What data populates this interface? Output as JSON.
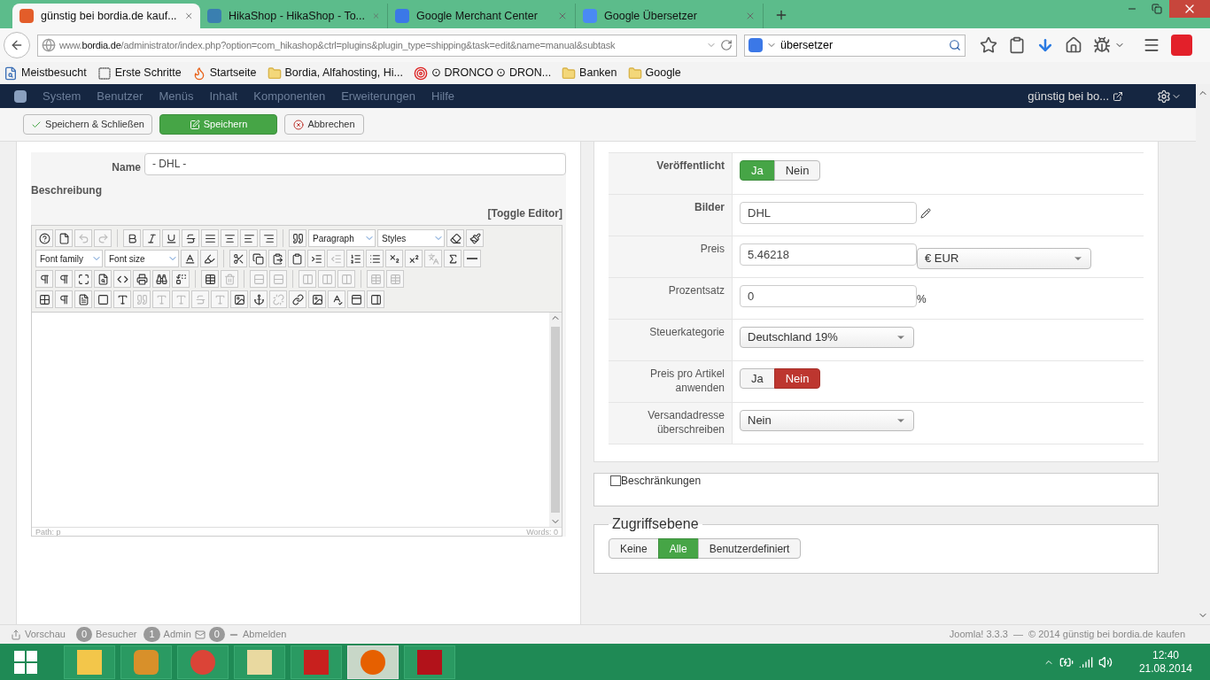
{
  "browser": {
    "tabs": [
      {
        "title": "günstig bei bordia.de kauf...",
        "kind": "joomla",
        "selected": true
      },
      {
        "title": "HikaShop - HikaShop - To...",
        "kind": "hika",
        "selected": false
      },
      {
        "title": "Google Merchant Center",
        "kind": "google",
        "selected": false
      },
      {
        "title": "Google Übersetzer",
        "kind": "translate",
        "selected": false
      }
    ],
    "url": {
      "prefix": "www.",
      "domain": "bordia.de",
      "path": "/administrator/index.php?option=com_hikashop&ctrl=plugins&plugin_type=shipping&task=edit&name=manual&subtask"
    },
    "search": {
      "value": "übersetzer"
    },
    "bookmarks": [
      {
        "label": "Meistbesucht",
        "kind": "page"
      },
      {
        "label": "Erste Schritte",
        "kind": "dashed"
      },
      {
        "label": "Startseite",
        "kind": "fire"
      },
      {
        "label": "Bordia, Alfahosting, Hi...",
        "kind": "folder"
      },
      {
        "label": "⊙ DRONCO ⊙ DRON...",
        "kind": "target"
      },
      {
        "label": "Banken",
        "kind": "folder"
      },
      {
        "label": "Google",
        "kind": "folder"
      }
    ]
  },
  "admin_menu": {
    "items": [
      "System",
      "Benutzer",
      "Menüs",
      "Inhalt",
      "Komponenten",
      "Erweiterungen",
      "Hilfe"
    ],
    "site_link": "günstig bei bo..."
  },
  "toolbar": [
    {
      "label": "Speichern & Schließen",
      "kind": "save-close"
    },
    {
      "label": "Speichern",
      "kind": "save"
    },
    {
      "label": "Abbrechen",
      "kind": "cancel"
    }
  ],
  "form": {
    "name_label": "Name",
    "name_value": "- DHL -",
    "description_label": "Beschreibung",
    "toggle_editor": "[Toggle Editor]",
    "editor": {
      "paragraph": "Paragraph",
      "styles": "Styles",
      "font_family": "Font family",
      "font_size": "Font size",
      "path": "Path: p",
      "words": "Words: 0"
    }
  },
  "settings": [
    {
      "label": "Veröffentlicht",
      "kind": "toggle",
      "bold": true,
      "options": [
        {
          "label": "Ja",
          "selected": true
        },
        {
          "label": "Nein",
          "selected": false
        }
      ]
    },
    {
      "label": "Bilder",
      "kind": "image",
      "bold": true,
      "value": "DHL"
    },
    {
      "label": "Preis",
      "kind": "price",
      "bold": false,
      "value": "5.46218",
      "currency": "€ EUR"
    },
    {
      "label": "Prozentsatz",
      "kind": "percent",
      "bold": false,
      "value": "0",
      "unit": "%"
    },
    {
      "label": "Steuerkategorie",
      "kind": "select",
      "bold": false,
      "value": "Deutschland 19%"
    },
    {
      "label": "Preis pro Artikel anwenden",
      "kind": "toggle",
      "bold": false,
      "options": [
        {
          "label": "Ja",
          "selected": false
        },
        {
          "label": "Nein",
          "selected": true
        }
      ]
    },
    {
      "label": "Versandadresse überschreiben",
      "kind": "select",
      "bold": false,
      "value": "Nein"
    }
  ],
  "restrictions": {
    "label": "Beschränkungen",
    "checked": false
  },
  "access": {
    "legend": "Zugriffsebene",
    "options": [
      {
        "label": "Keine",
        "selected": false
      },
      {
        "label": "Alle",
        "selected": true
      },
      {
        "label": "Benutzerdefiniert",
        "selected": false
      }
    ]
  },
  "status_bar": {
    "preview": "Vorschau",
    "visitors_count": "0",
    "visitors_label": "Besucher",
    "admin_count": "1",
    "admin_label": "Admin",
    "messages_count": "0",
    "logout": "Abmelden",
    "footer": "Joomla! 3.3.3  —  © 2014 günstig bei bordia.de kaufen"
  },
  "taskbar": {
    "apps": [
      {
        "kind": "explorer",
        "selected": false
      },
      {
        "kind": "notes",
        "selected": false
      },
      {
        "kind": "chrome",
        "selected": false
      },
      {
        "kind": "mail",
        "selected": false
      },
      {
        "kind": "pdf",
        "selected": false
      },
      {
        "kind": "firefox",
        "selected": true
      },
      {
        "kind": "ftp",
        "selected": false
      }
    ],
    "time": "12:40",
    "date": "21.08.2014"
  }
}
